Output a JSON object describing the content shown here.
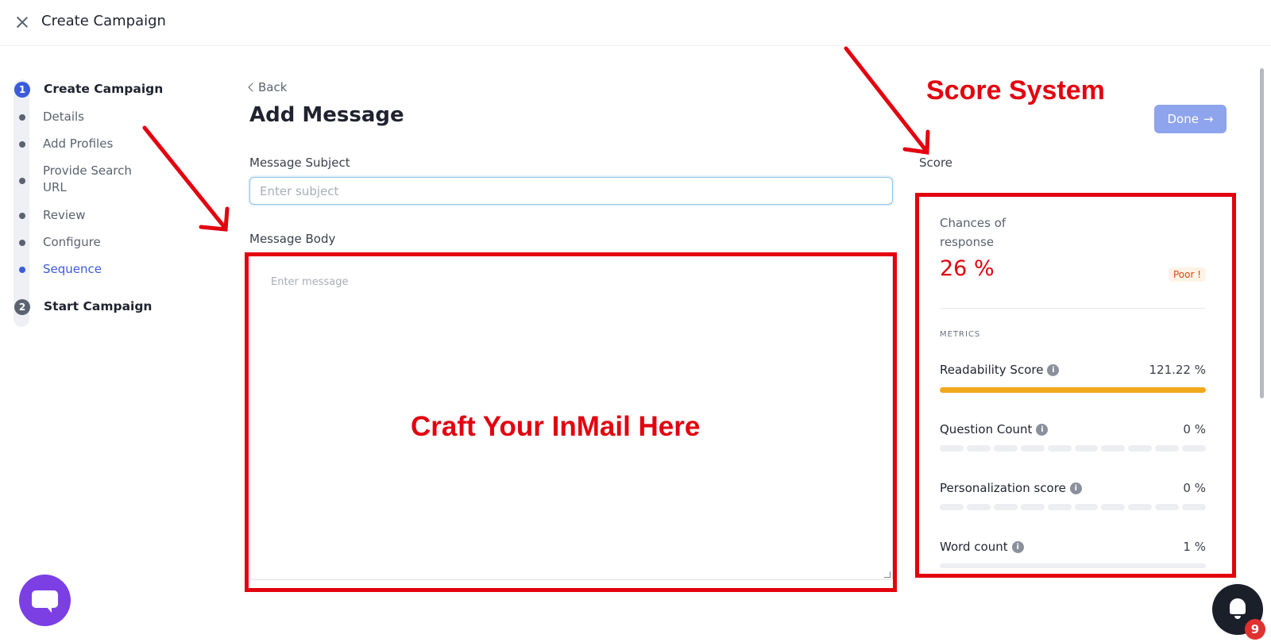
{
  "header": {
    "title": "Create Campaign"
  },
  "stepper": {
    "steps": [
      {
        "number": "1",
        "label": "Create Campaign"
      },
      {
        "number": "2",
        "label": "Start Campaign"
      }
    ],
    "substeps": [
      "Details",
      "Add Profiles",
      "Provide Search URL",
      "Review",
      "Configure",
      "Sequence"
    ],
    "active_substep": "Sequence"
  },
  "main": {
    "back_label": "Back",
    "title": "Add Message",
    "subject_label": "Message Subject",
    "subject_placeholder": "Enter subject",
    "body_label": "Message Body",
    "body_placeholder": "Enter message"
  },
  "score": {
    "label": "Score",
    "done_label": "Done",
    "chances_label": "Chances of response",
    "value": "26 %",
    "rating": "Poor !",
    "metrics_heading": "METRICS",
    "metrics": [
      {
        "name": "Readability Score",
        "value": "121.22 %",
        "fraction": 1.0
      },
      {
        "name": "Question Count",
        "value": "0 %",
        "fraction": 0
      },
      {
        "name": "Personalization score",
        "value": "0 %",
        "fraction": 0
      },
      {
        "name": "Word count",
        "value": "1 %",
        "fraction": 0.01
      }
    ]
  },
  "annotations": {
    "score_system": "Score System",
    "craft_inmail": "Craft Your InMail Here"
  },
  "notifications": {
    "count": "9"
  },
  "colors": {
    "accent": "#3b5bdb",
    "annotation_red": "#e3000f",
    "readability_bar": "#f2a81d",
    "chat_purple": "#7b3fe4"
  }
}
